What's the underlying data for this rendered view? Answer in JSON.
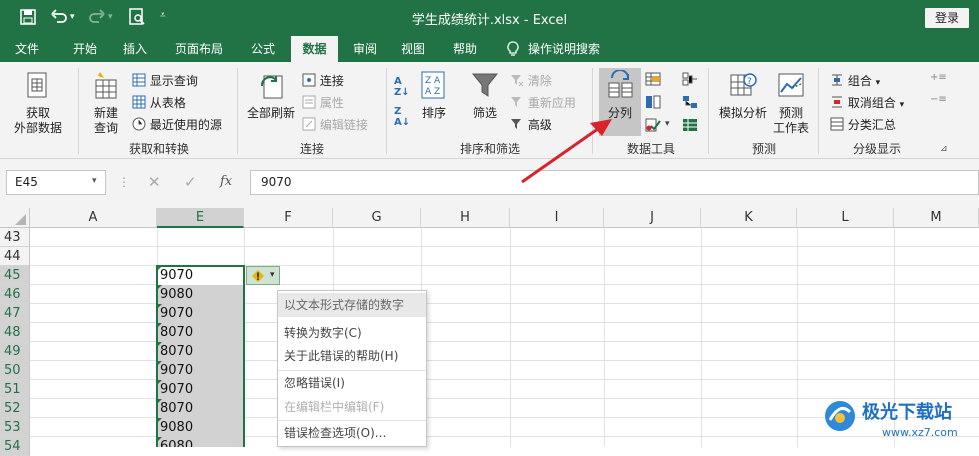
{
  "title_bar": {
    "file_title": "学生成绩统计.xlsx  -  Excel",
    "login_label": "登录"
  },
  "ribbon_tabs": [
    "文件",
    "开始",
    "插入",
    "页面布局",
    "公式",
    "数据",
    "审阅",
    "视图",
    "帮助",
    "操作说明搜索"
  ],
  "active_tab": "数据",
  "ribbon": {
    "get_external_data": "获取\n外部数据",
    "new_query": "新建\n查询",
    "show_query": "显示查询",
    "from_table": "从表格",
    "recent_sources": "最近使用的源",
    "group_get_transform": "获取和转换",
    "refresh_all": "全部刷新",
    "connections": "连接",
    "properties": "属性",
    "edit_links": "编辑链接",
    "group_connections": "连接",
    "sort": "排序",
    "filter": "筛选",
    "clear": "清除",
    "reapply": "重新应用",
    "advanced": "高级",
    "group_sort_filter": "排序和筛选",
    "split_column": "分列",
    "group_data_tools": "数据工具",
    "what_if": "模拟分析",
    "forecast_sheet": "预测\n工作表",
    "group_forecast": "预测",
    "group_btn": "组合",
    "ungroup_btn": "取消组合",
    "subtotal": "分类汇总",
    "group_outline": "分级显示"
  },
  "formula_bar": {
    "name_box": "E45",
    "fx_label": "fx",
    "formula": "9070"
  },
  "columns": [
    "A",
    "E",
    "F",
    "G",
    "H",
    "I",
    "J",
    "K",
    "L",
    "M"
  ],
  "rows": [
    "43",
    "44",
    "45",
    "46",
    "47",
    "48",
    "49",
    "50",
    "51",
    "52",
    "53",
    "54"
  ],
  "column_e_values": [
    "",
    "",
    "9070",
    "9080",
    "9070",
    "8070",
    "8070",
    "9070",
    "9070",
    "8070",
    "9080",
    "6080"
  ],
  "error_menu": {
    "header": "以文本形式存储的数字",
    "items": [
      "转换为数字(C)",
      "关于此错误的帮助(H)",
      "忽略错误(I)",
      "在编辑栏中编辑(F)",
      "错误检查选项(O)..."
    ]
  },
  "watermark": {
    "brand": "极光下载站",
    "url": "www.xz7.com"
  },
  "colors": {
    "excel_green": "#217346",
    "ribbon_bg": "#f3f3f3",
    "arrow_red": "#d9232a",
    "error_icon": "#e8b700"
  }
}
